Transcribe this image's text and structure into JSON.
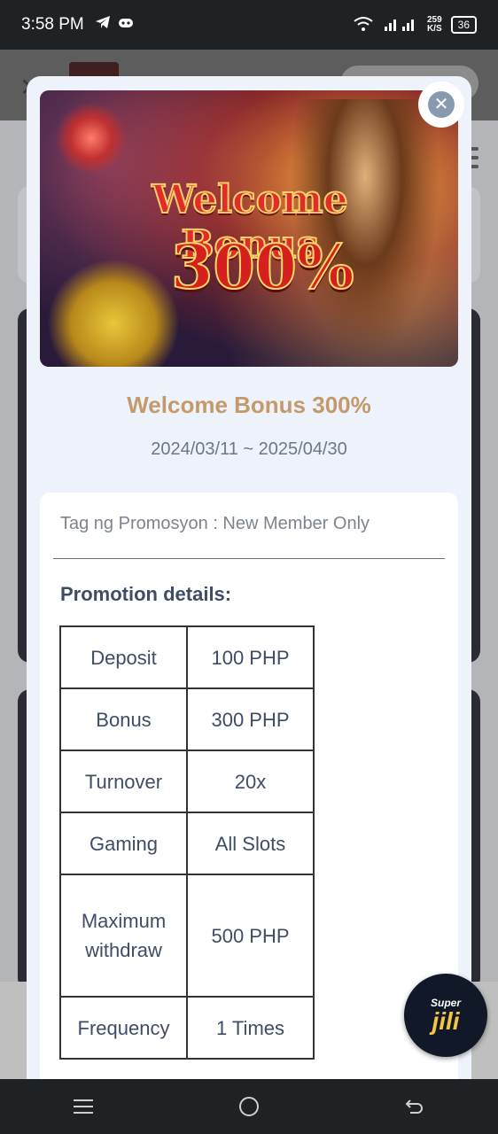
{
  "status_bar": {
    "time": "3:58 PM",
    "net_speed_value": "259",
    "net_speed_unit": "K/S",
    "battery": "36"
  },
  "modal": {
    "banner": {
      "line1": "Welcome Bonus",
      "line2": "300%"
    },
    "title": "Welcome Bonus 300%",
    "date_range": "2024/03/11 ~ 2025/04/30",
    "tag_line": "Tag ng Promosyon : New Member Only",
    "details_heading": "Promotion details:",
    "table": [
      {
        "label": "Deposit",
        "value": "100 PHP"
      },
      {
        "label": "Bonus",
        "value": "300 PHP"
      },
      {
        "label": "Turnover",
        "value": "20x"
      },
      {
        "label": "Gaming",
        "value": "All Slots"
      },
      {
        "label": "Maximum withdraw",
        "value": "500 PHP"
      },
      {
        "label": "Frequency",
        "value": "1 Times"
      }
    ]
  },
  "fab": {
    "line1": "Super",
    "line2": "jili"
  },
  "icons": {
    "close": "close-icon",
    "nav_menu": "recent-apps-icon",
    "nav_home": "home-icon",
    "nav_back": "back-icon"
  }
}
